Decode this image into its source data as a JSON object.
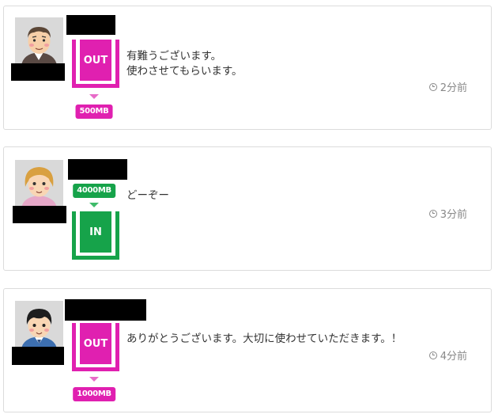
{
  "posts": [
    {
      "direction_label": "OUT",
      "amount": "500MB",
      "message_lines": [
        "有難うございます。",
        "使わさせてもらいます。"
      ],
      "time": "2分前",
      "avatar": "man-with-glasses-icon"
    },
    {
      "direction_label": "IN",
      "amount": "4000MB",
      "message_lines": [
        "どーぞー"
      ],
      "time": "3分前",
      "avatar": "woman-blonde-icon"
    },
    {
      "direction_label": "OUT",
      "amount": "1000MB",
      "message_lines": [
        "ありがとうございます。大切に使わせていただきます。！"
      ],
      "time": "4分前",
      "avatar": "young-man-icon"
    }
  ],
  "colors": {
    "out": "#e020b0",
    "in": "#16a34a"
  }
}
